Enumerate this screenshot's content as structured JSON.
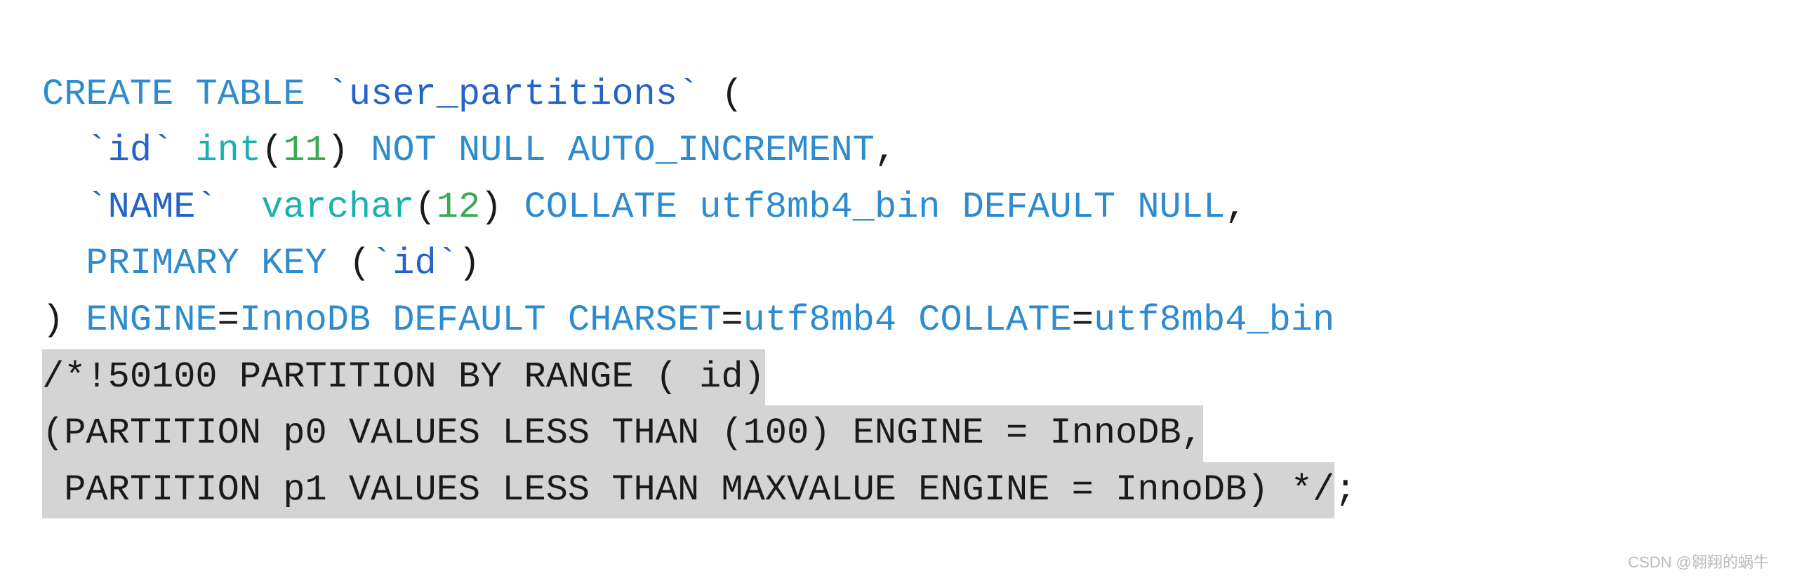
{
  "code": {
    "lines": [
      {
        "id": "line1",
        "parts": [
          {
            "text": "CREATE TABLE ",
            "class": "kw-blue"
          },
          {
            "text": "`user_partitions`",
            "class": "kw-dark-blue"
          },
          {
            "text": " (",
            "class": "text-dark"
          }
        ]
      },
      {
        "id": "line2",
        "parts": [
          {
            "text": "  ",
            "class": "text-plain"
          },
          {
            "text": "`id`",
            "class": "kw-dark-blue"
          },
          {
            "text": " ",
            "class": "text-plain"
          },
          {
            "text": "int",
            "class": "kw-cyan"
          },
          {
            "text": "(",
            "class": "text-dark"
          },
          {
            "text": "11",
            "class": "kw-green"
          },
          {
            "text": ") ",
            "class": "text-dark"
          },
          {
            "text": "NOT NULL AUTO_INCREMENT",
            "class": "kw-blue"
          },
          {
            "text": ",",
            "class": "text-dark"
          }
        ]
      },
      {
        "id": "line3",
        "parts": [
          {
            "text": "  ",
            "class": "text-plain"
          },
          {
            "text": "`NAME`",
            "class": "kw-dark-blue"
          },
          {
            "text": "  ",
            "class": "text-plain"
          },
          {
            "text": "varchar",
            "class": "kw-cyan"
          },
          {
            "text": "(",
            "class": "text-dark"
          },
          {
            "text": "12",
            "class": "kw-green"
          },
          {
            "text": ") ",
            "class": "text-dark"
          },
          {
            "text": "COLLATE",
            "class": "kw-blue"
          },
          {
            "text": " utf8mb4_bin ",
            "class": "kw-blue"
          },
          {
            "text": "DEFAULT NULL",
            "class": "kw-blue"
          },
          {
            "text": ",",
            "class": "text-dark"
          }
        ]
      },
      {
        "id": "line4",
        "parts": [
          {
            "text": "  ",
            "class": "text-plain"
          },
          {
            "text": "PRIMARY KEY",
            "class": "kw-blue"
          },
          {
            "text": " (",
            "class": "text-dark"
          },
          {
            "text": "`id`",
            "class": "kw-dark-blue"
          },
          {
            "text": ")",
            "class": "text-dark"
          }
        ]
      },
      {
        "id": "line5",
        "parts": [
          {
            "text": ") ",
            "class": "text-dark"
          },
          {
            "text": "ENGINE",
            "class": "kw-blue"
          },
          {
            "text": "=",
            "class": "text-dark"
          },
          {
            "text": "InnoDB",
            "class": "kw-blue"
          },
          {
            "text": " ",
            "class": "text-plain"
          },
          {
            "text": "DEFAULT",
            "class": "kw-blue"
          },
          {
            "text": " ",
            "class": "text-plain"
          },
          {
            "text": "CHARSET",
            "class": "kw-blue"
          },
          {
            "text": "=",
            "class": "text-dark"
          },
          {
            "text": "utf8mb4",
            "class": "kw-blue"
          },
          {
            "text": " ",
            "class": "text-plain"
          },
          {
            "text": "COLLATE",
            "class": "kw-blue"
          },
          {
            "text": "=",
            "class": "text-dark"
          },
          {
            "text": "utf8mb4_bin",
            "class": "kw-blue"
          }
        ]
      },
      {
        "id": "line6",
        "parts": [
          {
            "text": "/*!50100 PARTITION BY RANGE ( id)",
            "class": "kw-blue",
            "highlight": true
          }
        ]
      },
      {
        "id": "line7",
        "parts": [
          {
            "text": "(PARTITION p0 VALUES LESS THAN (100) ENGINE = InnoDB,",
            "class": "kw-blue",
            "highlight": true
          }
        ]
      },
      {
        "id": "line8",
        "parts": [
          {
            "text": " PARTITION p1 VALUES LESS THAN MAXVALUE ENGINE = InnoDB) */",
            "class": "kw-blue",
            "highlight": true
          },
          {
            "text": ";",
            "class": "text-dark"
          }
        ]
      }
    ],
    "watermark": "CSDN @翱翔的蜗牛"
  }
}
